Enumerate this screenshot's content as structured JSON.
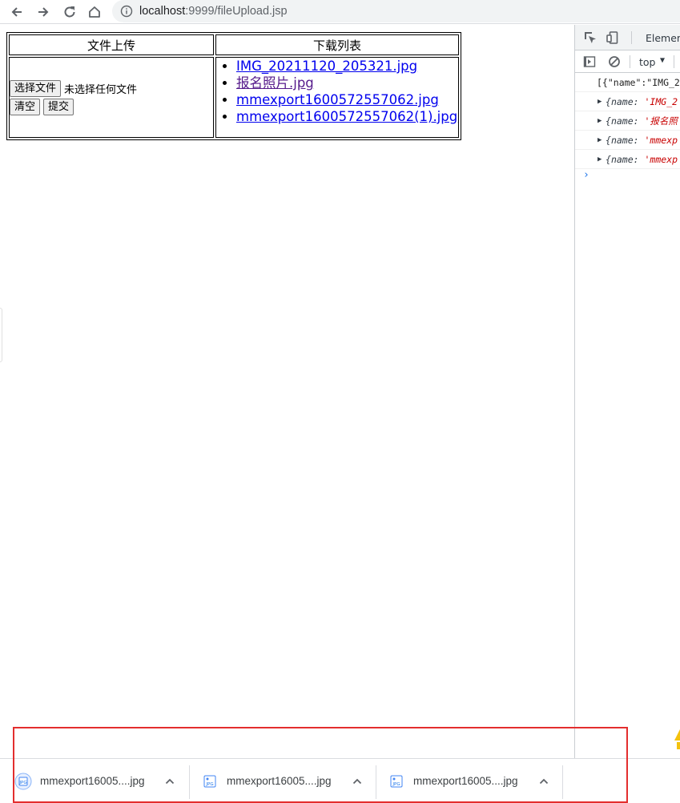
{
  "browser": {
    "url_host": "localhost",
    "url_rest": ":9999/fileUpload.jsp"
  },
  "page": {
    "table": {
      "header_upload": "文件上传",
      "header_download": "下载列表",
      "choose_file_label": "选择文件",
      "no_file_text": "未选择任何文件",
      "clear_label": "清空",
      "submit_label": "提交",
      "files": [
        {
          "name": "IMG_20211120_205321.jpg",
          "visited": false
        },
        {
          "name": "报名照片.jpg",
          "visited": true
        },
        {
          "name": "mmexport1600572557062.jpg",
          "visited": false
        },
        {
          "name": "mmexport1600572557062(1).jpg",
          "visited": false
        }
      ]
    }
  },
  "devtools": {
    "tab_label": "Elemen",
    "context_label": "top",
    "console_first_line": "[{\"name\":\"IMG_2",
    "objects": [
      {
        "key": "name",
        "value": "'IMG_2"
      },
      {
        "key": "name",
        "value": "'报名照"
      },
      {
        "key": "name",
        "value": "'mmexp"
      },
      {
        "key": "name",
        "value": "'mmexp"
      }
    ],
    "prompt": "›"
  },
  "downloads": {
    "items": [
      {
        "name": "mmexport16005....jpg",
        "icon": "jpg-file-icon"
      },
      {
        "name": "mmexport16005....jpg",
        "icon": "jpg-file-icon"
      },
      {
        "name": "mmexport16005....jpg",
        "icon": "jpg-file-icon"
      }
    ]
  },
  "colors": {
    "link": "#0000ee",
    "visited_link": "#551a8b",
    "annotation": "#e32e2e"
  }
}
